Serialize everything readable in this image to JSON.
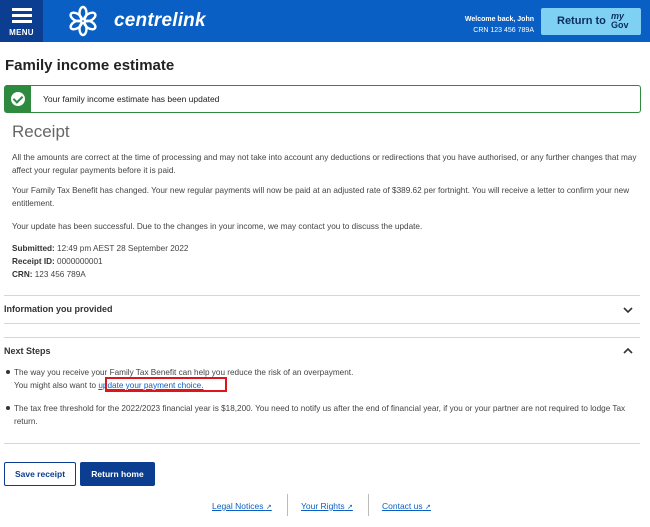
{
  "header": {
    "menu_label": "MENU",
    "brand": "centrelink",
    "welcome": "Welcome back, John",
    "crn": "CRN 123 456 789A",
    "mygov_button_label": "Return to",
    "mygov_logo_top": "my",
    "mygov_logo_bottom": "Gov",
    "colors": {
      "header_bg": "#0a5fc4",
      "menu_bg": "#0b3d91",
      "mygov_bg": "#7fd1f3"
    }
  },
  "page": {
    "title": "Family income estimate",
    "alert_text": "Your family income estimate has been updated",
    "receipt_title": "Receipt",
    "paragraphs": [
      "All the amounts are correct at the time of processing and may not take into account any deductions or redirections that you have authorised, or any further changes that may affect your regular payments before it is paid.",
      "Your Family Tax Benefit has changed. Your new regular payments will now be paid at an adjusted rate of $389.62 per fortnight. You will receive a letter to confirm your new entitlement.",
      "Your update has been successful. Due to the changes in your income, we may contact you to discuss the update."
    ],
    "submitted_label": "Submitted:",
    "submitted_value": "12:49 pm AEST 28 September 2022",
    "receipt_id_label": "Receipt ID:",
    "receipt_id_value": "0000000001",
    "crn_label": "CRN:",
    "crn_value": "123 456 789A"
  },
  "sections": {
    "info_title": "Information you provided",
    "next_steps_title": "Next Steps",
    "next_steps": {
      "item1_line1": "The way you receive your Family Tax Benefit can help you reduce the risk of an overpayment.",
      "item1_line2_prefix": "You might also want to ",
      "item1_link": "update your payment choice.",
      "item2": "The tax free threshold for the 2022/2023 financial year is $18,200. You need to notify us after the end of financial year, if you or your partner are not required to lodge Tax return."
    }
  },
  "buttons": {
    "save_receipt": "Save receipt",
    "return_home": "Return home"
  },
  "footer": {
    "legal": "Legal Notices",
    "rights": "Your Rights",
    "contact": "Contact us",
    "external_icon": "external-link-icon"
  }
}
